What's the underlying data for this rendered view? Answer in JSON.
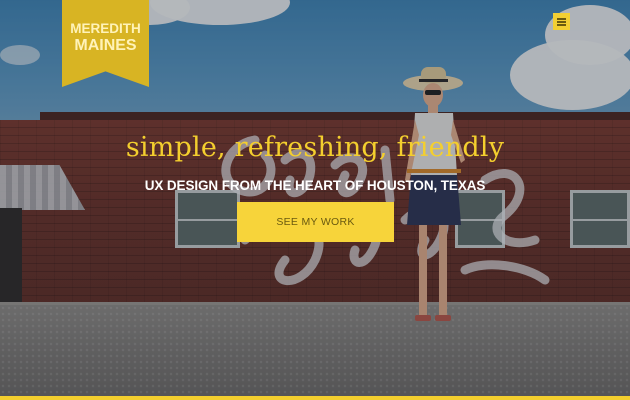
{
  "logo": {
    "line1": "MEREDITH",
    "line2": "MAINES"
  },
  "header": {
    "menu_icon": "hamburger-menu-icon"
  },
  "hero": {
    "tagline": "simple, refreshing, friendly",
    "subline": "UX DESIGN FROM THE HEART OF HOUSTON, TEXAS",
    "cta_label": "SEE MY WORK"
  },
  "colors": {
    "accent": "#f4cf2e",
    "logo_bg": "#d8b423",
    "button_text": "#6a5a10"
  }
}
